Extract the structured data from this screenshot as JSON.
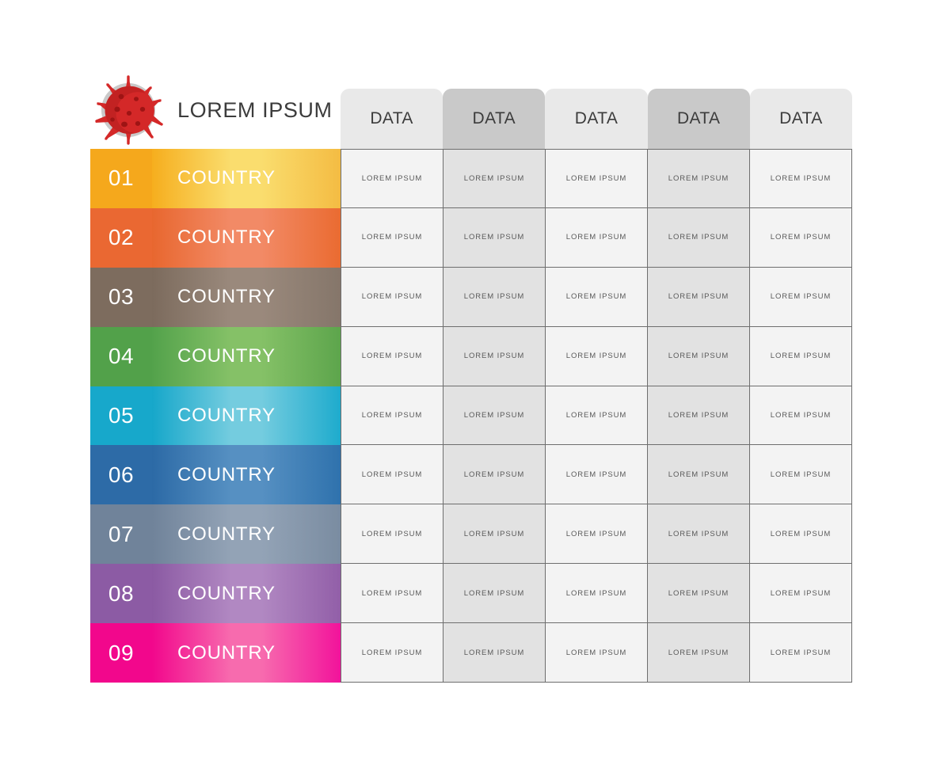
{
  "header": {
    "title": "LOREM IPSUM",
    "icon": "virus-icon",
    "columns": [
      {
        "label": "DATA",
        "shade": "light"
      },
      {
        "label": "DATA",
        "shade": "dark"
      },
      {
        "label": "DATA",
        "shade": "light"
      },
      {
        "label": "DATA",
        "shade": "dark"
      },
      {
        "label": "DATA",
        "shade": "light"
      }
    ]
  },
  "colors": {
    "header_light": "#e9e9e9",
    "header_dark": "#c9c9c9",
    "cell_light": "#f3f3f3",
    "cell_dark": "#e2e2e2",
    "grid_line": "#6e6e6e",
    "title_text": "#3c3c3c",
    "cell_text": "#5a5a5a",
    "virus_body": "#d42828",
    "virus_body_dark": "#b31d1d",
    "virus_halo": "#c9c9c9"
  },
  "rows": [
    {
      "number": "01",
      "country": "COUNTRY",
      "num_color": "#f5a81c",
      "grad_start": "#f6ae1e",
      "grad_mid": "#fadd6e",
      "grad_end": "#f4bc43",
      "cells": [
        "LOREM IPSUM",
        "LOREM IPSUM",
        "LOREM IPSUM",
        "LOREM IPSUM",
        "LOREM IPSUM"
      ]
    },
    {
      "number": "02",
      "country": "COUNTRY",
      "num_color": "#ea6832",
      "grad_start": "#e8672f",
      "grad_mid": "#f28a66",
      "grad_end": "#ea6b31",
      "cells": [
        "LOREM IPSUM",
        "LOREM IPSUM",
        "LOREM IPSUM",
        "LOREM IPSUM",
        "LOREM IPSUM"
      ]
    },
    {
      "number": "03",
      "country": "COUNTRY",
      "num_color": "#7d6c5e",
      "grad_start": "#7c6b5d",
      "grad_mid": "#9a897c",
      "grad_end": "#85766a",
      "cells": [
        "LOREM IPSUM",
        "LOREM IPSUM",
        "LOREM IPSUM",
        "LOREM IPSUM",
        "LOREM IPSUM"
      ]
    },
    {
      "number": "04",
      "country": "COUNTRY",
      "num_color": "#52a14a",
      "grad_start": "#53a24b",
      "grad_mid": "#85c167",
      "grad_end": "#5da54c",
      "cells": [
        "LOREM IPSUM",
        "LOREM IPSUM",
        "LOREM IPSUM",
        "LOREM IPSUM",
        "LOREM IPSUM"
      ]
    },
    {
      "number": "05",
      "country": "COUNTRY",
      "num_color": "#17a8cb",
      "grad_start": "#16a7ca",
      "grad_mid": "#74ccdf",
      "grad_end": "#1eabcd",
      "cells": [
        "LOREM IPSUM",
        "LOREM IPSUM",
        "LOREM IPSUM",
        "LOREM IPSUM",
        "LOREM IPSUM"
      ]
    },
    {
      "number": "06",
      "country": "COUNTRY",
      "num_color": "#2d6ba7",
      "grad_start": "#2c6aa6",
      "grad_mid": "#5690c2",
      "grad_end": "#2f72ad",
      "cells": [
        "LOREM IPSUM",
        "LOREM IPSUM",
        "LOREM IPSUM",
        "LOREM IPSUM",
        "LOREM IPSUM"
      ]
    },
    {
      "number": "07",
      "country": "COUNTRY",
      "num_color": "#70839a",
      "grad_start": "#70839a",
      "grad_mid": "#93a3b6",
      "grad_end": "#7a8ca1",
      "cells": [
        "LOREM IPSUM",
        "LOREM IPSUM",
        "LOREM IPSUM",
        "LOREM IPSUM",
        "LOREM IPSUM"
      ]
    },
    {
      "number": "08",
      "country": "COUNTRY",
      "num_color": "#8c5ba4",
      "grad_start": "#8b5aa3",
      "grad_mid": "#b188c2",
      "grad_end": "#925fa8",
      "cells": [
        "LOREM IPSUM",
        "LOREM IPSUM",
        "LOREM IPSUM",
        "LOREM IPSUM",
        "LOREM IPSUM"
      ]
    },
    {
      "number": "09",
      "country": "COUNTRY",
      "num_color": "#f2078c",
      "grad_start": "#f2078c",
      "grad_mid": "#f76bae",
      "grad_end": "#f2139b",
      "cells": [
        "LOREM IPSUM",
        "LOREM IPSUM",
        "LOREM IPSUM",
        "LOREM IPSUM",
        "LOREM IPSUM"
      ]
    }
  ]
}
